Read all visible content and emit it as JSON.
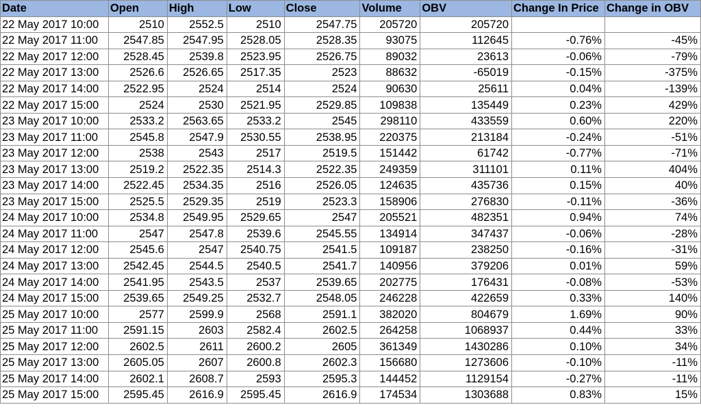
{
  "sheet": {
    "headers": [
      "Date",
      "Open",
      "High",
      "Low",
      "Close",
      "Volume",
      "OBV",
      "Change In Price",
      "Change in OBV"
    ],
    "rows": [
      [
        "22 May 2017 10:00",
        "2510",
        "2552.5",
        "2510",
        "2547.75",
        "205720",
        "205720",
        "",
        ""
      ],
      [
        "22 May 2017 11:00",
        "2547.85",
        "2547.95",
        "2528.05",
        "2528.35",
        "93075",
        "112645",
        "-0.76%",
        "-45%"
      ],
      [
        "22 May 2017 12:00",
        "2528.45",
        "2539.8",
        "2523.95",
        "2526.75",
        "89032",
        "23613",
        "-0.06%",
        "-79%"
      ],
      [
        "22 May 2017 13:00",
        "2526.6",
        "2526.65",
        "2517.35",
        "2523",
        "88632",
        "-65019",
        "-0.15%",
        "-375%"
      ],
      [
        "22 May 2017 14:00",
        "2522.95",
        "2524",
        "2514",
        "2524",
        "90630",
        "25611",
        "0.04%",
        "-139%"
      ],
      [
        "22 May 2017 15:00",
        "2524",
        "2530",
        "2521.95",
        "2529.85",
        "109838",
        "135449",
        "0.23%",
        "429%"
      ],
      [
        "23 May 2017 10:00",
        "2533.2",
        "2563.65",
        "2533.2",
        "2545",
        "298110",
        "433559",
        "0.60%",
        "220%"
      ],
      [
        "23 May 2017 11:00",
        "2545.8",
        "2547.9",
        "2530.55",
        "2538.95",
        "220375",
        "213184",
        "-0.24%",
        "-51%"
      ],
      [
        "23 May 2017 12:00",
        "2538",
        "2543",
        "2517",
        "2519.5",
        "151442",
        "61742",
        "-0.77%",
        "-71%"
      ],
      [
        "23 May 2017 13:00",
        "2519.2",
        "2522.35",
        "2514.3",
        "2522.35",
        "249359",
        "311101",
        "0.11%",
        "404%"
      ],
      [
        "23 May 2017 14:00",
        "2522.45",
        "2534.35",
        "2516",
        "2526.05",
        "124635",
        "435736",
        "0.15%",
        "40%"
      ],
      [
        "23 May 2017 15:00",
        "2525.5",
        "2529.35",
        "2519",
        "2523.3",
        "158906",
        "276830",
        "-0.11%",
        "-36%"
      ],
      [
        "24 May 2017 10:00",
        "2534.8",
        "2549.95",
        "2529.65",
        "2547",
        "205521",
        "482351",
        "0.94%",
        "74%"
      ],
      [
        "24 May 2017 11:00",
        "2547",
        "2547.8",
        "2539.6",
        "2545.55",
        "134914",
        "347437",
        "-0.06%",
        "-28%"
      ],
      [
        "24 May 2017 12:00",
        "2545.6",
        "2547",
        "2540.75",
        "2541.5",
        "109187",
        "238250",
        "-0.16%",
        "-31%"
      ],
      [
        "24 May 2017 13:00",
        "2542.45",
        "2544.5",
        "2540.5",
        "2541.7",
        "140956",
        "379206",
        "0.01%",
        "59%"
      ],
      [
        "24 May 2017 14:00",
        "2541.95",
        "2543.5",
        "2537",
        "2539.65",
        "202775",
        "176431",
        "-0.08%",
        "-53%"
      ],
      [
        "24 May 2017 15:00",
        "2539.65",
        "2549.25",
        "2532.7",
        "2548.05",
        "246228",
        "422659",
        "0.33%",
        "140%"
      ],
      [
        "25 May 2017 10:00",
        "2577",
        "2599.9",
        "2568",
        "2591.1",
        "382020",
        "804679",
        "1.69%",
        "90%"
      ],
      [
        "25 May 2017 11:00",
        "2591.15",
        "2603",
        "2582.4",
        "2602.5",
        "264258",
        "1068937",
        "0.44%",
        "33%"
      ],
      [
        "25 May 2017 12:00",
        "2602.5",
        "2611",
        "2600.2",
        "2605",
        "361349",
        "1430286",
        "0.10%",
        "34%"
      ],
      [
        "25 May 2017 13:00",
        "2605.05",
        "2607",
        "2600.8",
        "2602.3",
        "156680",
        "1273606",
        "-0.10%",
        "-11%"
      ],
      [
        "25 May 2017 14:00",
        "2602.1",
        "2608.7",
        "2593",
        "2595.3",
        "144452",
        "1129154",
        "-0.27%",
        "-11%"
      ],
      [
        "25 May 2017 15:00",
        "2595.45",
        "2616.9",
        "2595.45",
        "2616.9",
        "174534",
        "1303688",
        "0.83%",
        "15%"
      ]
    ]
  }
}
